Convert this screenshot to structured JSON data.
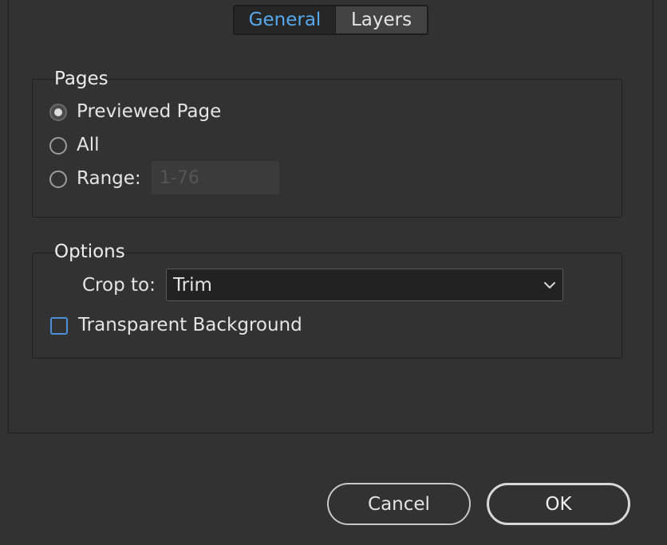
{
  "tabs": {
    "general": "General",
    "layers": "Layers"
  },
  "pages": {
    "title": "Pages",
    "options": [
      "Previewed Page",
      "All",
      "Range:"
    ],
    "selected": "Previewed Page",
    "range_placeholder": "1-76"
  },
  "options_group": {
    "title": "Options",
    "crop_label": "Crop to:",
    "crop_value": "Trim",
    "transparent_label": "Transparent Background",
    "transparent_checked": false
  },
  "buttons": {
    "cancel": "Cancel",
    "ok": "OK"
  },
  "colors": {
    "background": "#323232",
    "accent": "#57a9ee",
    "checkbox_border": "#4a8fd8"
  },
  "icons": {
    "select_chevron": "chevron-down-icon"
  }
}
